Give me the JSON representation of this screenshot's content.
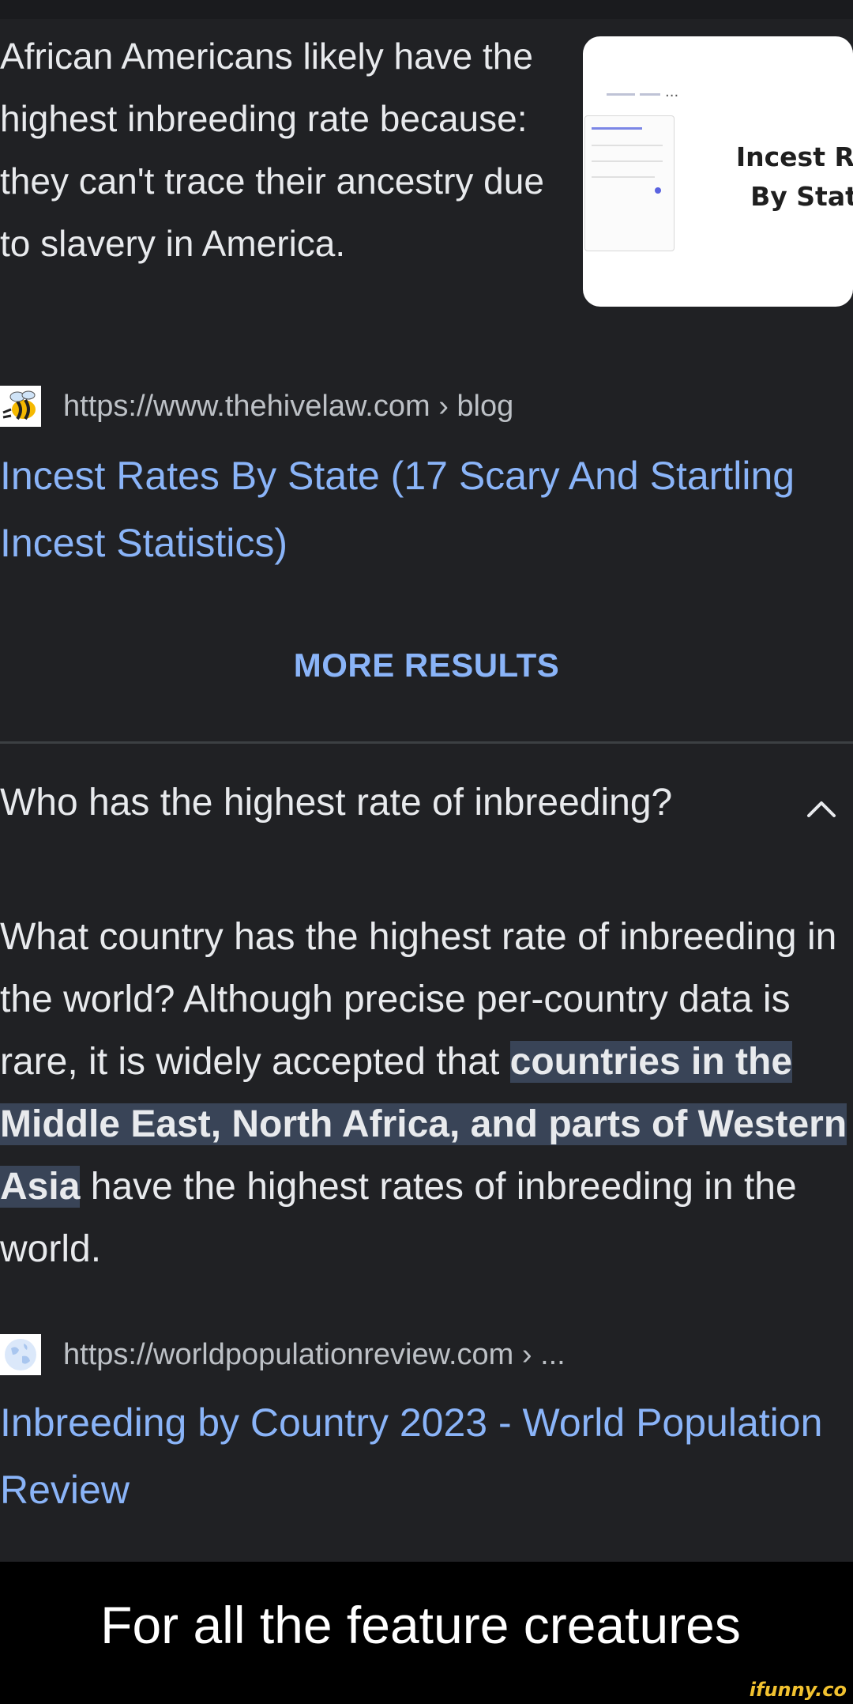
{
  "snippet": {
    "text": "African Americans likely have the highest inbreeding rate because: they can't trace their ancestry due to slavery in America.",
    "thumbnail": {
      "title_line1": "Incest Ra",
      "title_line2": "By Stat",
      "ellipsis": "..."
    }
  },
  "result1": {
    "favicon": "bee-icon",
    "url": "https://www.thehivelaw.com › blog",
    "link": "Incest Rates By State (17 Scary And Startling Incest Statistics)"
  },
  "more_results_label": "MORE RESULTS",
  "question": {
    "text": "Who has the highest rate of inbreeding?",
    "toggle_icon": "chevron-up-icon"
  },
  "answer": {
    "before": "What country has the highest rate of inbreeding in the world? Although precise per-country data is rare, it is widely accepted that ",
    "highlight": "countries in the Middle East, North Africa, and parts of Western Asia",
    "after": " have the highest rates of inbreeding in the world."
  },
  "result2": {
    "favicon": "globe-icon",
    "url": "https://worldpopulationreview.com › ...",
    "link": "Inbreeding by Country 2023 - World Population Review"
  },
  "caption": "For all the feature creatures",
  "watermark": "ifunny.co",
  "colors": {
    "background": "#202124",
    "link": "#8ab4f8",
    "highlight": "#394457",
    "text": "#e8eaed",
    "url_text": "#bdc1c6"
  }
}
